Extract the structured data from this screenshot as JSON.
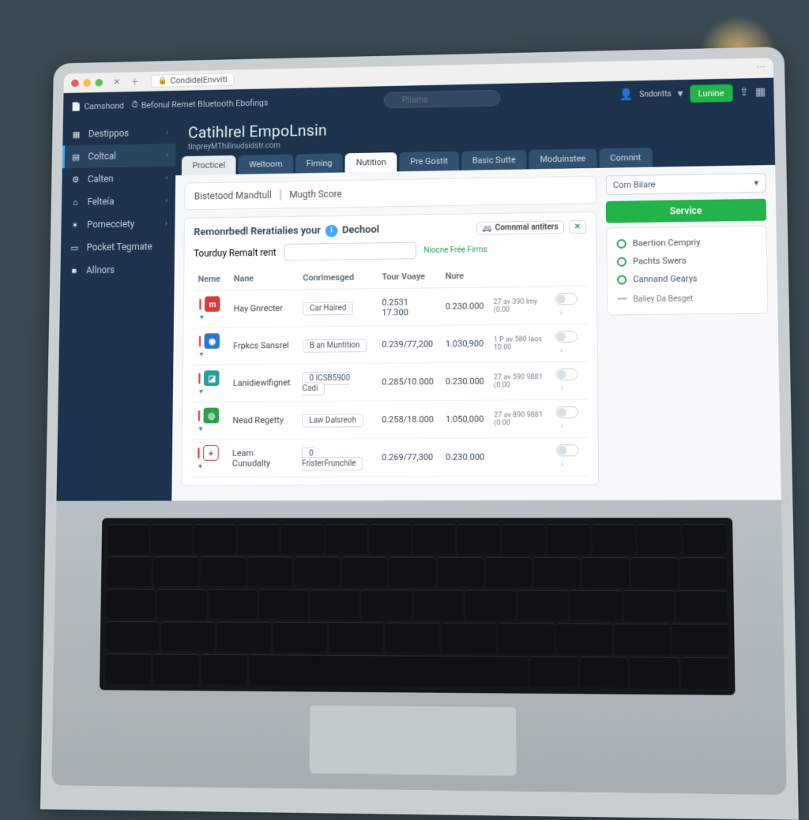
{
  "browser": {
    "url_label": "CondidelEnvvitl"
  },
  "header": {
    "crumbs": [
      "Camshond",
      "Befonul Remet Bluetooth Ebofings"
    ],
    "search_placeholder": "Pliams",
    "user_label": "Sndontts",
    "cta_label": "Lunine"
  },
  "sidebar": {
    "items": [
      {
        "icon": "▦",
        "label": "Destippos"
      },
      {
        "icon": "▤",
        "label": "Coltcal",
        "active": true
      },
      {
        "icon": "⚙",
        "label": "Calten"
      },
      {
        "icon": "⌂",
        "label": "Felteía"
      },
      {
        "icon": "✶",
        "label": "Pomecciety"
      },
      {
        "icon": "▭",
        "label": "Pocket Tegmate"
      },
      {
        "icon": "■",
        "label": "Allnors"
      }
    ]
  },
  "page": {
    "title": "Catihlrel EmpoLnsin",
    "subtitle": "tinpreyMThilinudsidstr.com"
  },
  "tabs": [
    {
      "label": "Procticel",
      "style": "light"
    },
    {
      "label": "Weltoom"
    },
    {
      "label": "Firning"
    },
    {
      "label": "Nutition",
      "style": "active"
    },
    {
      "label": "Pre Gostit"
    },
    {
      "label": "Basic Sutte"
    },
    {
      "label": "Moduinstee"
    },
    {
      "label": "Comnnt"
    }
  ],
  "score": {
    "a": "Bistetood Mandtull",
    "b": "Mugth Score"
  },
  "reco": {
    "title": "Remonrbedl Reratialies your",
    "badge": "Dechool",
    "chip": "Comnmal antiters",
    "chip_icon": "🚐",
    "chip2": "✕"
  },
  "search": {
    "label": "Tourduy Remalt rent",
    "placeholder": "",
    "hint": "Niocne Frée Firms"
  },
  "table": {
    "cols": [
      "Neme",
      "Nane",
      "Conrimesged",
      "Tour Voaye",
      "Nure",
      "",
      ""
    ],
    "rows": [
      {
        "ic": "red",
        "g": "m",
        "name": "Hay Gnrecter",
        "tag": "Car Haired",
        "v1": "0.2531 17.300",
        "v2": "0.230.000",
        "m": "27 av 390 lmy (0.00"
      },
      {
        "ic": "blue",
        "g": "◉",
        "name": "Frpkcs Sansrel",
        "tag": "B an Muntition",
        "v1": "0.239/77,200",
        "v2": "1.030,900",
        "m": "1 P av 580 laos 10.00"
      },
      {
        "ic": "teal",
        "g": "◪",
        "name": "Lanidiewlfignet",
        "tag": "0 ICSB5900 Cadi",
        "v1": "0.285/10.000",
        "v2": "0.230.000",
        "m": "27 av 590 9881 (0.00"
      },
      {
        "ic": "green",
        "g": "◎",
        "name": "Nead Regetty",
        "tag": "Law Dalsreoh",
        "v1": "0.258/18.000",
        "v2": "1.050,000",
        "m": "27 av 890 9881 (0.00"
      },
      {
        "ic": "white",
        "g": "+",
        "name": "Leam Cunudalty",
        "tag": "0 FristerFrunchile",
        "v1": "0.269/77,300",
        "v2": "0.230.000",
        "m": ""
      }
    ]
  },
  "side_panel": {
    "select": "Com Bilare",
    "cta": "Service",
    "options": [
      "Baertion Cempriy",
      "Pachts Swers",
      "Cannand Gearys"
    ],
    "footer": "Baliey Da Besget"
  }
}
